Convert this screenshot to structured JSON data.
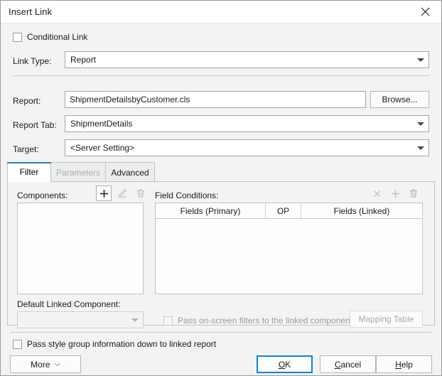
{
  "window": {
    "title": "Insert Link",
    "close_icon": "close-icon"
  },
  "conditional_link": {
    "label": "Conditional Link",
    "checked": false
  },
  "fields": {
    "link_type": {
      "label": "Link Type:",
      "value": "Report"
    },
    "report": {
      "label": "Report:",
      "value": "ShipmentDetailsbyCustomer.cls",
      "browse_label": "Browse..."
    },
    "report_tab": {
      "label": "Report Tab:",
      "value": "ShipmentDetails"
    },
    "target": {
      "label": "Target:",
      "value": "<Server Setting>"
    }
  },
  "tabs": [
    {
      "label": "Filter",
      "state": "active"
    },
    {
      "label": "Parameters",
      "state": "disabled"
    },
    {
      "label": "Advanced",
      "state": "normal"
    }
  ],
  "filter_panel": {
    "components": {
      "label": "Components:",
      "items": [],
      "toolbar": [
        {
          "name": "add-icon",
          "glyph": "+",
          "enabled": true
        },
        {
          "name": "edit-icon",
          "glyph": "pencil",
          "enabled": false
        },
        {
          "name": "delete-icon",
          "glyph": "trash",
          "enabled": false
        }
      ]
    },
    "default_linked_component": {
      "label": "Default Linked Component:",
      "value": "",
      "enabled": false
    },
    "field_conditions": {
      "label": "Field Conditions:",
      "toolbar": [
        {
          "name": "clear-icon",
          "glyph": "x",
          "enabled": false
        },
        {
          "name": "add-icon",
          "glyph": "+",
          "enabled": false
        },
        {
          "name": "delete-icon",
          "glyph": "trash",
          "enabled": false
        }
      ],
      "columns": [
        "Fields (Primary)",
        "OP",
        "Fields (Linked)"
      ],
      "rows": []
    },
    "pass_onscreen_filters": {
      "label": "Pass on-screen filters to the linked components",
      "checked": false,
      "enabled": false
    },
    "mapping_table_button": {
      "label": "Mapping Table",
      "enabled": false
    }
  },
  "footer": {
    "pass_style_group": {
      "label": "Pass style group information down to linked report",
      "checked": false
    },
    "more_button": "More",
    "more_glyph": "»",
    "ok_button": {
      "pre": "",
      "accel": "O",
      "post": "K"
    },
    "cancel_button": {
      "pre": "",
      "accel": "C",
      "post": "ancel"
    },
    "help_button": {
      "pre": "",
      "accel": "H",
      "post": "elp"
    }
  },
  "colors": {
    "accent_blue": "#0a84d8",
    "tab_accent": "#2b7fc4",
    "dialog_bg": "#f3f3f2",
    "field_bg": "#ffffff"
  }
}
